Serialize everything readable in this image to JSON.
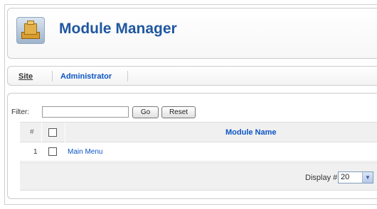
{
  "header": {
    "title": "Module Manager",
    "icon": "module-manager-icon"
  },
  "submenu": {
    "items": [
      {
        "label": "Site",
        "active": true
      },
      {
        "label": "Administrator",
        "active": false
      }
    ]
  },
  "filter": {
    "label": "Filter:",
    "value": "",
    "go_label": "Go",
    "reset_label": "Reset"
  },
  "table": {
    "columns": [
      "#",
      "",
      "Module Name"
    ],
    "rows": [
      {
        "num": "1",
        "name": "Main Menu"
      }
    ]
  },
  "pagination": {
    "display_label": "Display #",
    "display_value": "20"
  },
  "colors": {
    "link": "#0b55c4",
    "title": "#1f57a1",
    "header_bg": "#f0f0f0"
  }
}
